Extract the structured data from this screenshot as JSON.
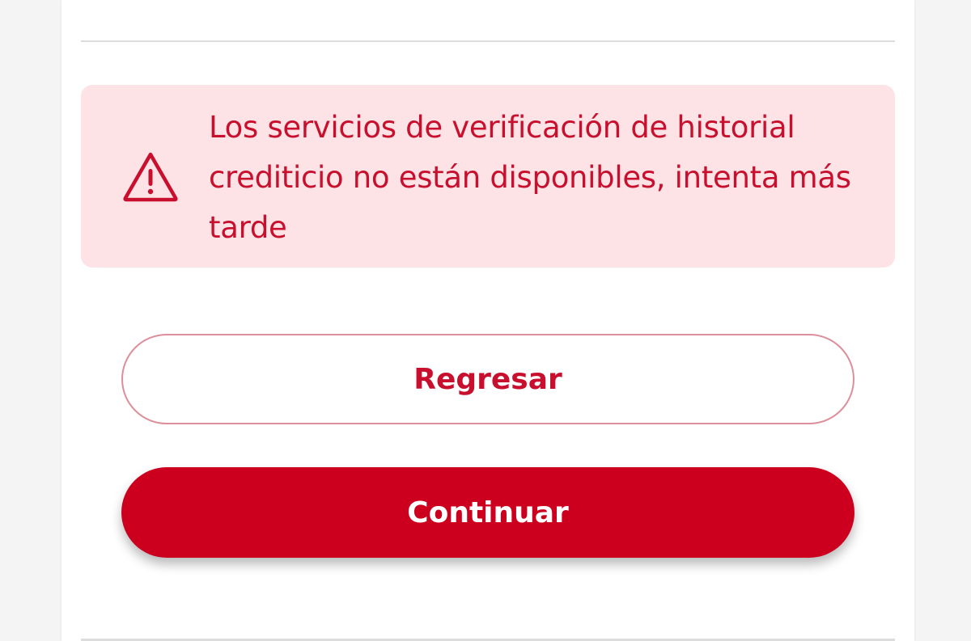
{
  "alert": {
    "icon": "warning-triangle-icon",
    "message": "Los servicios de verificación de historial crediticio no están disponibles, intenta más tarde",
    "background_color": "#fde3e6",
    "text_color": "#c8102e"
  },
  "actions": {
    "back_label": "Regresar",
    "continue_label": "Continuar",
    "primary_color": "#cc001e"
  }
}
